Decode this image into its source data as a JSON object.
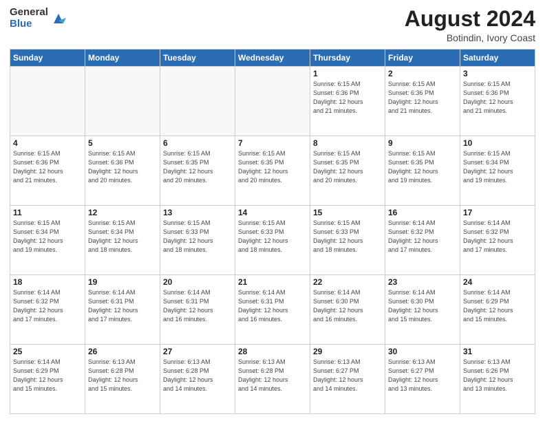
{
  "logo": {
    "general": "General",
    "blue": "Blue"
  },
  "title": {
    "month": "August 2024",
    "location": "Botindin, Ivory Coast"
  },
  "weekdays": [
    "Sunday",
    "Monday",
    "Tuesday",
    "Wednesday",
    "Thursday",
    "Friday",
    "Saturday"
  ],
  "weeks": [
    [
      {
        "day": "",
        "info": ""
      },
      {
        "day": "",
        "info": ""
      },
      {
        "day": "",
        "info": ""
      },
      {
        "day": "",
        "info": ""
      },
      {
        "day": "1",
        "sunrise": "6:15 AM",
        "sunset": "6:36 PM",
        "daylight": "12 hours and 21 minutes."
      },
      {
        "day": "2",
        "sunrise": "6:15 AM",
        "sunset": "6:36 PM",
        "daylight": "12 hours and 21 minutes."
      },
      {
        "day": "3",
        "sunrise": "6:15 AM",
        "sunset": "6:36 PM",
        "daylight": "12 hours and 21 minutes."
      }
    ],
    [
      {
        "day": "4",
        "sunrise": "6:15 AM",
        "sunset": "6:36 PM",
        "daylight": "12 hours and 21 minutes."
      },
      {
        "day": "5",
        "sunrise": "6:15 AM",
        "sunset": "6:36 PM",
        "daylight": "12 hours and 20 minutes."
      },
      {
        "day": "6",
        "sunrise": "6:15 AM",
        "sunset": "6:35 PM",
        "daylight": "12 hours and 20 minutes."
      },
      {
        "day": "7",
        "sunrise": "6:15 AM",
        "sunset": "6:35 PM",
        "daylight": "12 hours and 20 minutes."
      },
      {
        "day": "8",
        "sunrise": "6:15 AM",
        "sunset": "6:35 PM",
        "daylight": "12 hours and 20 minutes."
      },
      {
        "day": "9",
        "sunrise": "6:15 AM",
        "sunset": "6:35 PM",
        "daylight": "12 hours and 19 minutes."
      },
      {
        "day": "10",
        "sunrise": "6:15 AM",
        "sunset": "6:34 PM",
        "daylight": "12 hours and 19 minutes."
      }
    ],
    [
      {
        "day": "11",
        "sunrise": "6:15 AM",
        "sunset": "6:34 PM",
        "daylight": "12 hours and 19 minutes."
      },
      {
        "day": "12",
        "sunrise": "6:15 AM",
        "sunset": "6:34 PM",
        "daylight": "12 hours and 18 minutes."
      },
      {
        "day": "13",
        "sunrise": "6:15 AM",
        "sunset": "6:33 PM",
        "daylight": "12 hours and 18 minutes."
      },
      {
        "day": "14",
        "sunrise": "6:15 AM",
        "sunset": "6:33 PM",
        "daylight": "12 hours and 18 minutes."
      },
      {
        "day": "15",
        "sunrise": "6:15 AM",
        "sunset": "6:33 PM",
        "daylight": "12 hours and 18 minutes."
      },
      {
        "day": "16",
        "sunrise": "6:14 AM",
        "sunset": "6:32 PM",
        "daylight": "12 hours and 17 minutes."
      },
      {
        "day": "17",
        "sunrise": "6:14 AM",
        "sunset": "6:32 PM",
        "daylight": "12 hours and 17 minutes."
      }
    ],
    [
      {
        "day": "18",
        "sunrise": "6:14 AM",
        "sunset": "6:32 PM",
        "daylight": "12 hours and 17 minutes."
      },
      {
        "day": "19",
        "sunrise": "6:14 AM",
        "sunset": "6:31 PM",
        "daylight": "12 hours and 17 minutes."
      },
      {
        "day": "20",
        "sunrise": "6:14 AM",
        "sunset": "6:31 PM",
        "daylight": "12 hours and 16 minutes."
      },
      {
        "day": "21",
        "sunrise": "6:14 AM",
        "sunset": "6:31 PM",
        "daylight": "12 hours and 16 minutes."
      },
      {
        "day": "22",
        "sunrise": "6:14 AM",
        "sunset": "6:30 PM",
        "daylight": "12 hours and 16 minutes."
      },
      {
        "day": "23",
        "sunrise": "6:14 AM",
        "sunset": "6:30 PM",
        "daylight": "12 hours and 15 minutes."
      },
      {
        "day": "24",
        "sunrise": "6:14 AM",
        "sunset": "6:29 PM",
        "daylight": "12 hours and 15 minutes."
      }
    ],
    [
      {
        "day": "25",
        "sunrise": "6:14 AM",
        "sunset": "6:29 PM",
        "daylight": "12 hours and 15 minutes."
      },
      {
        "day": "26",
        "sunrise": "6:13 AM",
        "sunset": "6:28 PM",
        "daylight": "12 hours and 15 minutes."
      },
      {
        "day": "27",
        "sunrise": "6:13 AM",
        "sunset": "6:28 PM",
        "daylight": "12 hours and 14 minutes."
      },
      {
        "day": "28",
        "sunrise": "6:13 AM",
        "sunset": "6:28 PM",
        "daylight": "12 hours and 14 minutes."
      },
      {
        "day": "29",
        "sunrise": "6:13 AM",
        "sunset": "6:27 PM",
        "daylight": "12 hours and 14 minutes."
      },
      {
        "day": "30",
        "sunrise": "6:13 AM",
        "sunset": "6:27 PM",
        "daylight": "12 hours and 13 minutes."
      },
      {
        "day": "31",
        "sunrise": "6:13 AM",
        "sunset": "6:26 PM",
        "daylight": "12 hours and 13 minutes."
      }
    ]
  ],
  "labels": {
    "sunrise": "Sunrise:",
    "sunset": "Sunset:",
    "daylight": "Daylight hours"
  }
}
